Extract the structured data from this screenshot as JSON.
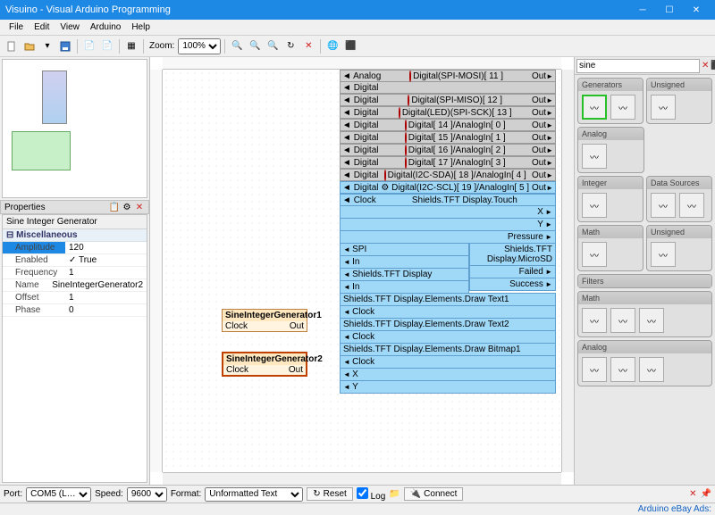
{
  "window": {
    "title": "Visuino - Visual Arduino Programming"
  },
  "menu": {
    "file": "File",
    "edit": "Edit",
    "view": "View",
    "arduino": "Arduino",
    "help": "Help"
  },
  "toolbar": {
    "zoom_label": "Zoom:",
    "zoom_value": "100%"
  },
  "left": {
    "properties_title": "Properties",
    "object_name": "Sine Integer Generator",
    "category": "Miscellaneous",
    "props": [
      {
        "k": "Amplitude",
        "v": "120",
        "sel": true
      },
      {
        "k": "Enabled",
        "v": "✓ True"
      },
      {
        "k": "Frequency",
        "v": "1"
      },
      {
        "k": "Name",
        "v": "SineIntegerGenerator2"
      },
      {
        "k": "Offset",
        "v": "1"
      },
      {
        "k": "Phase",
        "v": "0"
      }
    ]
  },
  "canvas": {
    "gen1": {
      "title": "SineIntegerGenerator1",
      "clock": "Clock",
      "out": "Out"
    },
    "gen2": {
      "title": "SineIntegerGenerator2",
      "clock": "Clock",
      "out": "Out"
    },
    "board_left": [
      {
        "a": "Analog",
        "b": "Digital"
      },
      {
        "a": "Digital"
      },
      {
        "a": "Digital"
      },
      {
        "a": "Digital"
      },
      {
        "a": "Digital"
      },
      {
        "a": "Digital"
      },
      {
        "a": "Digital"
      },
      {
        "a": "Digital",
        "blue": true
      },
      {
        "a": "Clock",
        "blue": true
      }
    ],
    "board_center": [
      "Digital(SPI-MOSI)[ 11 ]",
      "Digital(SPI-MISO)[ 12 ]",
      "Digital(LED)(SPI-SCK)[ 13 ]",
      "Digital[ 14 ]/AnalogIn[ 0 ]",
      "Digital[ 15 ]/AnalogIn[ 1 ]",
      "Digital[ 16 ]/AnalogIn[ 2 ]",
      "Digital[ 17 ]/AnalogIn[ 3 ]",
      "Digital(I2C-SDA)[ 18 ]/AnalogIn[ 4 ]",
      "Digital(I2C-SCL)[ 19 ]/AnalogIn[ 5 ]"
    ],
    "board_out": "Out",
    "shields_touch": "Shields.TFT Display.Touch",
    "touch_pins": [
      "X",
      "Y",
      "Pressure"
    ],
    "spi": "SPI",
    "spi_in": "In",
    "tft": "Shields.TFT Display",
    "tft_in": "In",
    "microsd": "Shields.TFT Display.MicroSD",
    "microsd_pins": [
      "Failed",
      "Success"
    ],
    "elements": [
      "Shields.TFT Display.Elements.Draw Text1",
      "Shields.TFT Display.Elements.Draw Text2",
      "Shields.TFT Display.Elements.Draw Bitmap1"
    ],
    "clock_lbl": "Clock",
    "xy": {
      "x": "X",
      "y": "Y"
    }
  },
  "right": {
    "search": "sine",
    "groups": {
      "generators": "Generators",
      "integer": "Integer",
      "unsigned": "Unsigned",
      "analog": "Analog",
      "data_sources": "Data Sources",
      "math": "Math",
      "unsigned2": "Unsigned",
      "filters": "Filters",
      "math2": "Math",
      "analog2": "Analog"
    }
  },
  "bottom": {
    "port_label": "Port:",
    "port_value": "COM5 (L…",
    "speed_label": "Speed:",
    "speed_value": "9600",
    "format_label": "Format:",
    "format_value": "Unformatted Text",
    "reset": "Reset",
    "log": "Log",
    "connect": "Connect"
  },
  "status": {
    "ads": "Arduino eBay Ads:"
  }
}
